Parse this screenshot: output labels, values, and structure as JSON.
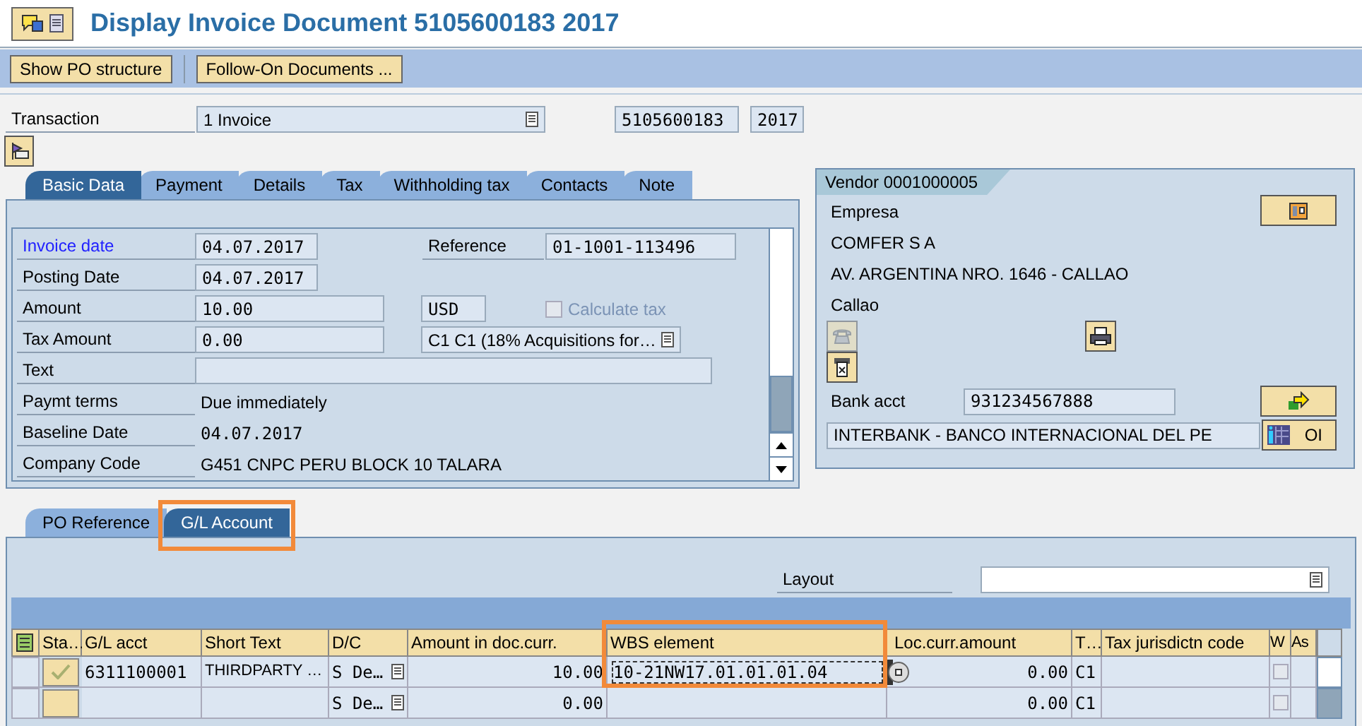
{
  "window": {
    "title": "Display Invoice Document 5105600183 2017"
  },
  "toolbar": {
    "buttons": [
      "Show PO structure",
      "Follow-On Documents ..."
    ]
  },
  "transaction": {
    "label": "Transaction",
    "value": "1 Invoice",
    "document_number": "5105600183",
    "fiscal_year": "2017"
  },
  "header_tabs": [
    {
      "label": "Basic Data",
      "selected": true
    },
    {
      "label": "Payment",
      "selected": false
    },
    {
      "label": "Details",
      "selected": false
    },
    {
      "label": "Tax",
      "selected": false
    },
    {
      "label": "Withholding tax",
      "selected": false
    },
    {
      "label": "Contacts",
      "selected": false
    },
    {
      "label": "Note",
      "selected": false
    }
  ],
  "basic_data": {
    "invoice_date": {
      "label": "Invoice date",
      "value": "04.07.2017"
    },
    "reference": {
      "label": "Reference",
      "value": "01-1001-113496"
    },
    "posting_date": {
      "label": "Posting Date",
      "value": "04.07.2017"
    },
    "amount": {
      "label": "Amount",
      "value": "10.00",
      "currency": "USD"
    },
    "calculate_tax": {
      "label": "Calculate tax",
      "checked": false,
      "disabled": true
    },
    "tax_amount": {
      "label": "Tax Amount",
      "value": "0.00",
      "tax_code": "C1 C1 (18% Acquisitions for…"
    },
    "text": {
      "label": "Text"
    },
    "payment_terms": {
      "label": "Paymt terms",
      "value": "Due immediately"
    },
    "baseline_date": {
      "label": "Baseline Date",
      "value": "04.07.2017"
    },
    "company_code": {
      "label": "Company Code",
      "value": "G451 CNPC PERU BLOCK 10 TALARA"
    }
  },
  "vendor": {
    "title": "Vendor 0001000005",
    "lines": [
      "Empresa",
      "COMFER S A",
      "AV. ARGENTINA NRO. 1646 - CALLAO",
      "Callao"
    ],
    "bank_label": "Bank acct",
    "bank_account": "931234567888",
    "bank_name": "INTERBANK - BANCO INTERNACIONAL DEL PE",
    "oi_button": "OI"
  },
  "item_tabs": [
    {
      "label": "PO Reference",
      "selected": false,
      "highlighted": false
    },
    {
      "label": "G/L Account",
      "selected": true,
      "highlighted": true
    }
  ],
  "layout": {
    "label": "Layout"
  },
  "table": {
    "columns": [
      {
        "label": "Sta…",
        "highlighted": false
      },
      {
        "label": "G/L acct",
        "highlighted": false
      },
      {
        "label": "Short Text",
        "highlighted": false
      },
      {
        "label": "D/C",
        "highlighted": false
      },
      {
        "label": "Amount in doc.curr.",
        "highlighted": false
      },
      {
        "label": "WBS element",
        "highlighted": true
      },
      {
        "label": "Loc.curr.amount",
        "highlighted": false
      },
      {
        "label": "T…",
        "highlighted": false
      },
      {
        "label": "Tax jurisdictn code",
        "highlighted": false
      },
      {
        "label": "W",
        "highlighted": false
      },
      {
        "label": "As",
        "highlighted": false
      }
    ],
    "rows": [
      {
        "status_ok": true,
        "gl_account": "6311100001",
        "short_text": "THIRDPARTY …",
        "dc": "S De…",
        "amount": "10.00",
        "wbs": "10-21NW17.01.01.01.04",
        "loc_amount": "0.00",
        "tax_code": "C1",
        "w_checked": false
      },
      {
        "status_ok": false,
        "dc": "S De…",
        "amount": "0.00",
        "loc_amount": "0.00",
        "tax_code": "C1",
        "w_checked": false
      }
    ]
  }
}
